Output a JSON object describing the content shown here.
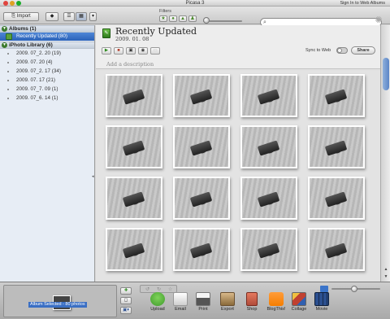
{
  "window": {
    "title": "Picasa 3",
    "sign_in": "Sign In to Web Albums",
    "traffic_colors": [
      "#e0443e",
      "#dea123",
      "#1aab29"
    ]
  },
  "toolbar": {
    "import_label": "Import",
    "filters_label": "Filters",
    "search_placeholder": ""
  },
  "sidebar": {
    "albums_header": "Albums (1)",
    "albums": [
      {
        "label": "Recently Updated (80)",
        "selected": true
      }
    ],
    "library_header": "iPhoto Library (6)",
    "library": [
      {
        "label": "2009. 07_2. 20 (19)"
      },
      {
        "label": "2009. 07. 20 (4)"
      },
      {
        "label": "2009. 07_2. 17 (34)"
      },
      {
        "label": "2009. 07. 17 (21)"
      },
      {
        "label": "2009. 07_7. 09 (1)"
      },
      {
        "label": "2009. 07_6. 14 (1)"
      }
    ]
  },
  "album": {
    "title": "Recently Updated",
    "date": "2009. 01. 08",
    "description_placeholder": "Add a description",
    "sync_label": "Sync to Web",
    "share_label": "Share"
  },
  "tray": {
    "selection_label": "Album Selected - 80 photos",
    "tools": [
      {
        "label": "Upload",
        "color": "#3f9a2d"
      },
      {
        "label": "Email",
        "color": "#e8e8e8"
      },
      {
        "label": "Print",
        "color": "#d8d8d8"
      },
      {
        "label": "Export",
        "color": "#9a7a4a"
      },
      {
        "label": "Shop",
        "color": "#b14b3a"
      },
      {
        "label": "BlogThis!",
        "color": "#f57d00"
      },
      {
        "label": "Collage",
        "color": "#c04030"
      },
      {
        "label": "Movie",
        "color": "#2b4f8f"
      }
    ]
  }
}
